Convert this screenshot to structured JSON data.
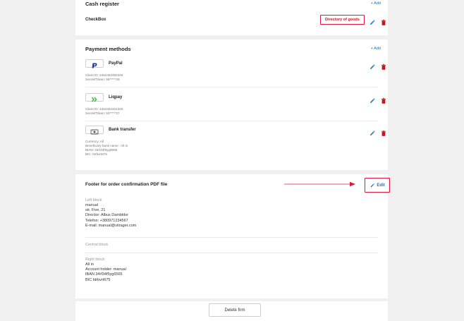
{
  "cash_register": {
    "title": "Cash register",
    "add_label": "+ Add",
    "item_name": "CheckBox",
    "directory_label": "Directory of goods"
  },
  "payment_methods": {
    "title": "Payment methods",
    "add_label": "+ Add",
    "items": [
      {
        "name": "PayPal",
        "logo": "paypal-logo",
        "details": [
          "Client ID: 2462452462346",
          "Secret/Token: 56*****26"
        ]
      },
      {
        "name": "Liqpay",
        "logo": "liqpay-logo",
        "details": [
          "Client ID: 4262454324325",
          "Secret/Token: 53*****37"
        ]
      },
      {
        "name": "Bank transfer",
        "logo": "bank-transfer-icon",
        "details": [
          "Currency: All",
          "Beneficiary bank name : All in",
          "IBAN: 34rf34f5yg6565",
          "BIC: btrbvrt675"
        ]
      }
    ]
  },
  "footer": {
    "title": "Footer for order confirmation PDF file",
    "edit_label": "Edit",
    "left_block": {
      "label": "Left block",
      "lines": [
        "manual",
        "str. Five, 21",
        "Director: Albus Dambldor",
        "Telefon: +380971234567",
        "E-mail: manual@vitrager.com"
      ]
    },
    "central_block": {
      "label": "Central block"
    },
    "right_block": {
      "label": "Right block",
      "lines": [
        "All in",
        "Account holder: manual",
        "IBAN 34rf34f5yg6565",
        "BIC btrbvrt675"
      ]
    }
  },
  "delete_firm_label": "Delete firm",
  "colors": {
    "accent": "#1a73c9",
    "danger": "#c4161c",
    "annotation": "#e0173c"
  }
}
